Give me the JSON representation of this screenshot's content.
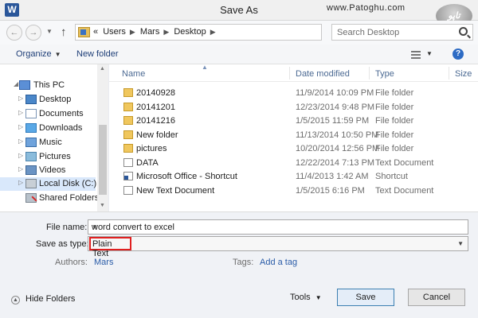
{
  "window": {
    "title": "Save As",
    "app_icon": "W"
  },
  "watermark": {
    "text": "www.Patoghu.com",
    "logo": "تاپو"
  },
  "address": {
    "prefix": "«",
    "crumbs": [
      "Users",
      "Mars",
      "Desktop"
    ],
    "search_placeholder": "Search Desktop"
  },
  "toolbar": {
    "organize": "Organize",
    "new_folder": "New folder"
  },
  "sidebar": {
    "items": [
      {
        "label": "This PC",
        "icon": "computer-icon"
      },
      {
        "label": "Desktop",
        "icon": "desktop-icon"
      },
      {
        "label": "Documents",
        "icon": "documents-icon"
      },
      {
        "label": "Downloads",
        "icon": "downloads-icon"
      },
      {
        "label": "Music",
        "icon": "music-icon"
      },
      {
        "label": "Pictures",
        "icon": "pictures-icon"
      },
      {
        "label": "Videos",
        "icon": "videos-icon"
      },
      {
        "label": "Local Disk (C:)",
        "icon": "disk-icon"
      },
      {
        "label": "Shared Folders (\\",
        "icon": "network-drive-icon"
      }
    ]
  },
  "filelist": {
    "columns": [
      "Name",
      "Date modified",
      "Type",
      "Size"
    ],
    "rows": [
      {
        "name": "20140928",
        "date": "11/9/2014 10:09 PM",
        "type": "File folder",
        "icon": "folder-icon"
      },
      {
        "name": "20141201",
        "date": "12/23/2014 9:48 PM",
        "type": "File folder",
        "icon": "folder-icon"
      },
      {
        "name": "20141216",
        "date": "1/5/2015 11:59 PM",
        "type": "File folder",
        "icon": "folder-icon"
      },
      {
        "name": "New folder",
        "date": "11/13/2014 10:50 PM",
        "type": "File folder",
        "icon": "folder-icon"
      },
      {
        "name": "pictures",
        "date": "10/20/2014 12:56 PM",
        "type": "File folder",
        "icon": "folder-icon"
      },
      {
        "name": "DATA",
        "date": "12/22/2014 7:13 PM",
        "type": "Text Document",
        "icon": "document-icon"
      },
      {
        "name": "Microsoft Office - Shortcut",
        "date": "11/4/2013 1:42 AM",
        "type": "Shortcut",
        "icon": "shortcut-icon"
      },
      {
        "name": "New Text Document",
        "date": "1/5/2015 6:16 PM",
        "type": "Text Document",
        "icon": "document-icon"
      }
    ]
  },
  "form": {
    "file_name_label": "File name:",
    "file_name_value": "word convert to excel",
    "save_type_label": "Save as type:",
    "save_type_value": "Plain Text",
    "authors_label": "Authors:",
    "authors_value": "Mars",
    "tags_label": "Tags:",
    "tags_value": "Add a tag"
  },
  "footer": {
    "hide_folders": "Hide Folders",
    "tools": "Tools",
    "save": "Save",
    "cancel": "Cancel"
  },
  "colors": {
    "accent": "#2a5ca8",
    "highlight": "#e02020"
  }
}
